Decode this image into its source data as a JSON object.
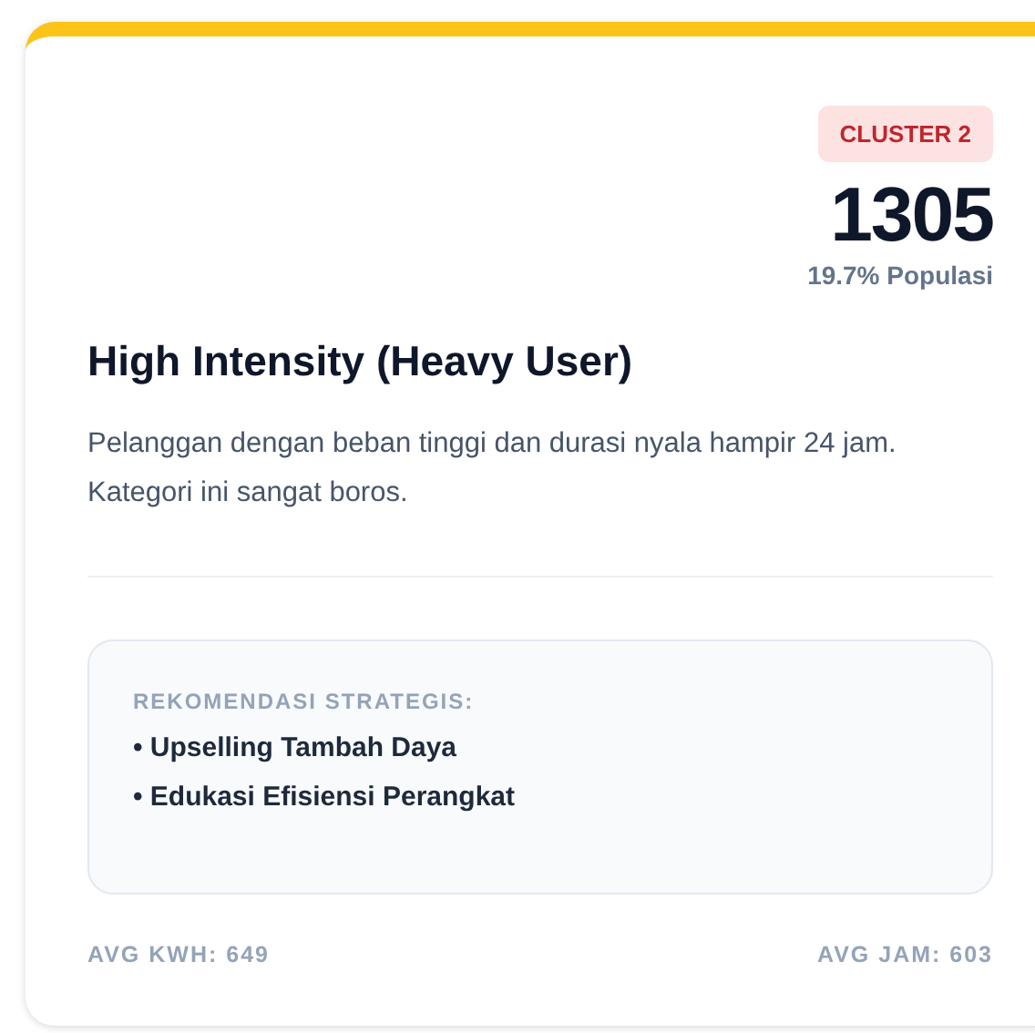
{
  "badge": "CLUSTER 2",
  "count": "1305",
  "population": "19.7% Populasi",
  "title": "High Intensity (Heavy User)",
  "description": "Pelanggan dengan beban tinggi dan durasi nyala hampir 24 jam. Kategori ini sangat boros.",
  "recommendation": {
    "heading": "REKOMENDASI STRATEGIS:",
    "items": [
      "• Upselling Tambah Daya",
      "• Edukasi Efisiensi Perangkat"
    ]
  },
  "footer": {
    "left": "AVG KWH: 649",
    "right": "AVG JAM: 603"
  }
}
